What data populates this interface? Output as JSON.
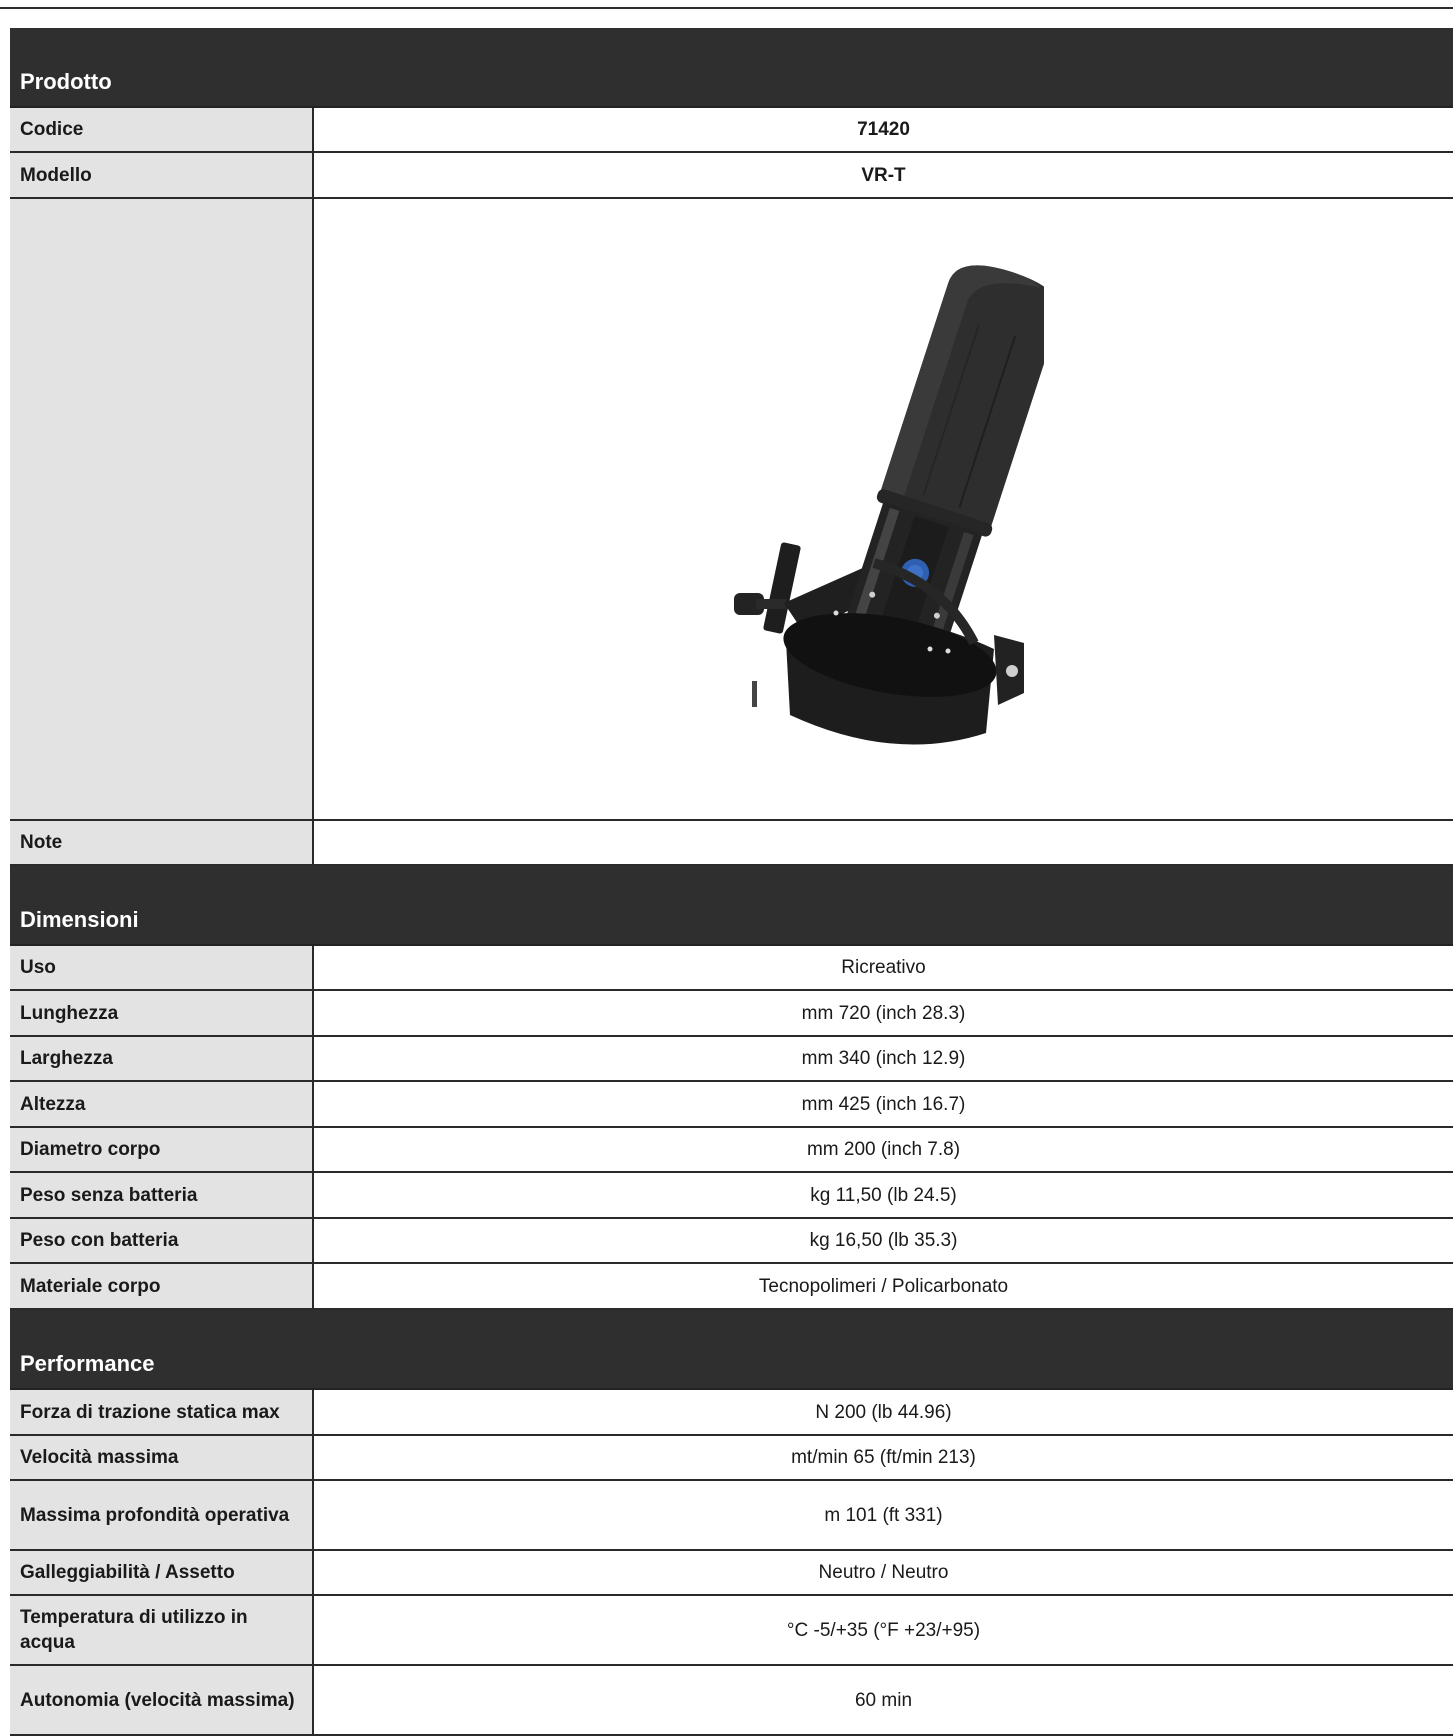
{
  "sections": {
    "prodotto": {
      "title": "Prodotto",
      "codice_label": "Codice",
      "codice_value": "71420",
      "modello_label": "Modello",
      "modello_value": "VR-T",
      "note_label": "Note",
      "note_value": ""
    },
    "dimensioni": {
      "title": "Dimensioni",
      "rows": [
        {
          "label": "Uso",
          "value": "Ricreativo"
        },
        {
          "label": "Lunghezza",
          "value": "mm 720 (inch 28.3)"
        },
        {
          "label": "Larghezza",
          "value": "mm 340 (inch 12.9)"
        },
        {
          "label": "Altezza",
          "value": "mm 425 (inch 16.7)"
        },
        {
          "label": "Diametro corpo",
          "value": "mm 200 (inch 7.8)"
        },
        {
          "label": "Peso senza batteria",
          "value": "kg 11,50 (lb 24.5)"
        },
        {
          "label": "Peso con batteria",
          "value": "kg 16,50 (lb 35.3)"
        },
        {
          "label": "Materiale corpo",
          "value": "Tecnopolimeri / Policarbonato"
        }
      ]
    },
    "performance": {
      "title": "Performance",
      "rows": [
        {
          "label": "Forza di trazione statica max",
          "value": "N 200 (lb 44.96)"
        },
        {
          "label": "Velocità massima",
          "value": "mt/min 65 (ft/min 213)"
        },
        {
          "label": "Massima profondità operativa",
          "value": "m 101 (ft 331)"
        },
        {
          "label": "Galleggiabilità / Assetto",
          "value": "Neutro / Neutro"
        },
        {
          "label": "Temperatura di utilizzo in acqua",
          "value": "°C -5/+35 (°F +23/+95)"
        },
        {
          "label": "Autonomia (velocità massima)",
          "value": "60 min"
        }
      ]
    }
  },
  "product_image": {
    "icon": "underwater-scooter-image",
    "body_color": "#2b2b2b",
    "button_color": "#2f5fb0"
  }
}
